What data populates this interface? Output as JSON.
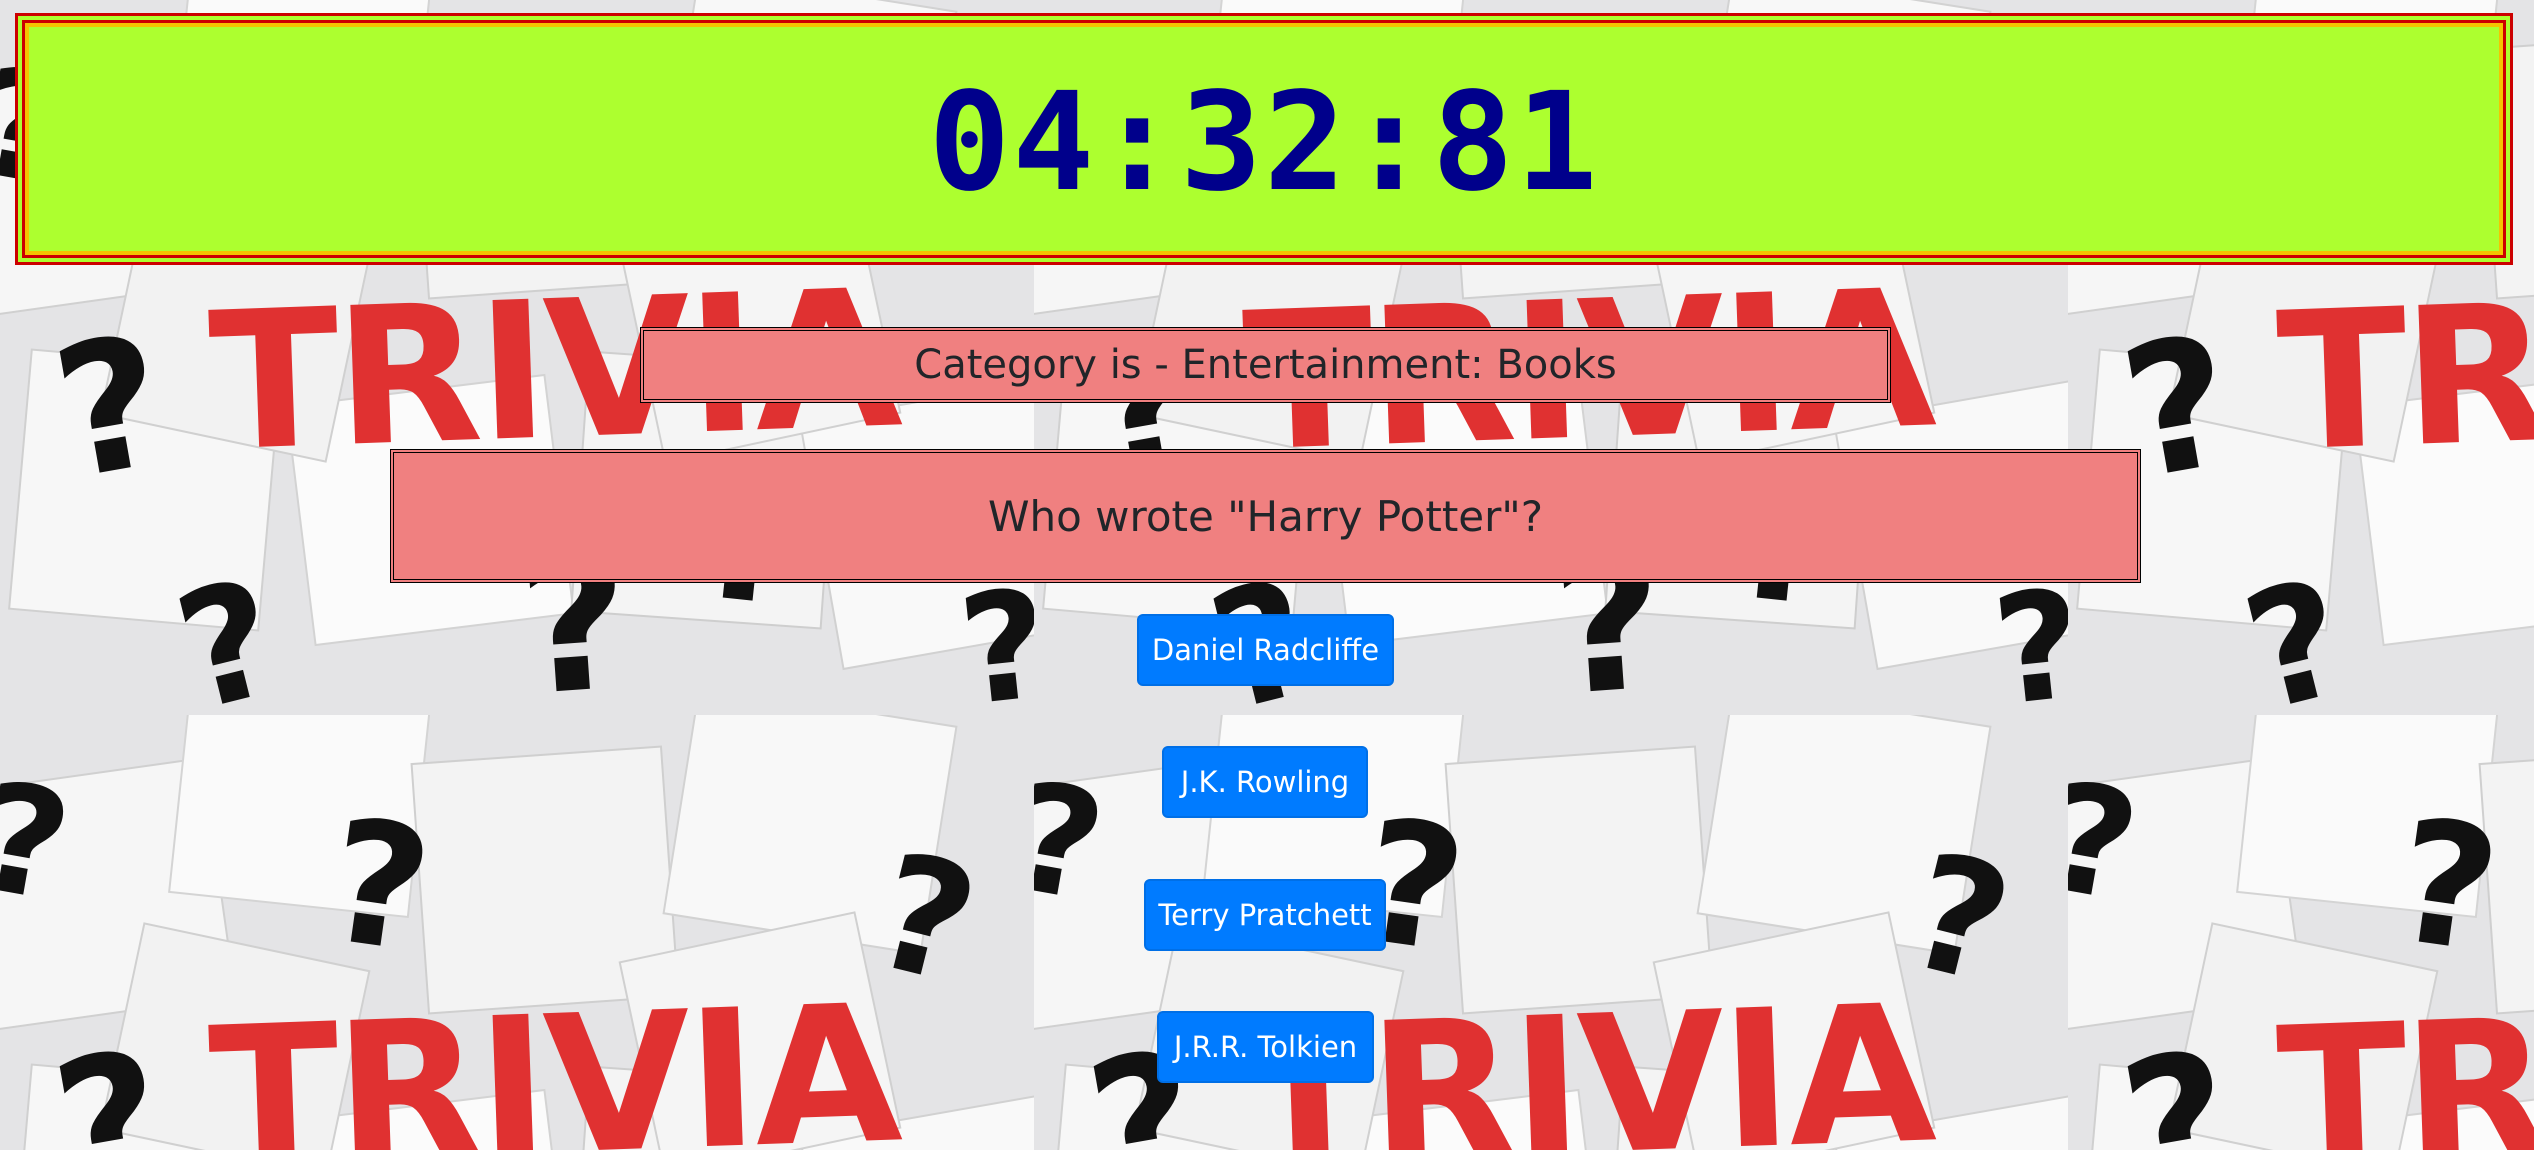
{
  "timer": {
    "display": "04:32:81"
  },
  "category": {
    "text": "Category is - Entertainment: Books"
  },
  "question": {
    "text": "Who wrote \"Harry Potter\"?"
  },
  "answers": [
    {
      "label": "Daniel Radcliffe"
    },
    {
      "label": "J.K. Rowling"
    },
    {
      "label": "Terry Pratchett"
    },
    {
      "label": "J.R.R. Tolkien"
    }
  ],
  "background": {
    "watermark_word": "TRIVIA",
    "symbol": "?"
  },
  "colors": {
    "timer_background": "#adff2f",
    "timer_text": "#00008b",
    "timer_border_outer": "#cc0000",
    "timer_border_inner": "#f5c400",
    "card_background": "#f08080",
    "button_background": "#007bff",
    "button_text": "#ffffff",
    "trivia_word": "#e03131"
  }
}
